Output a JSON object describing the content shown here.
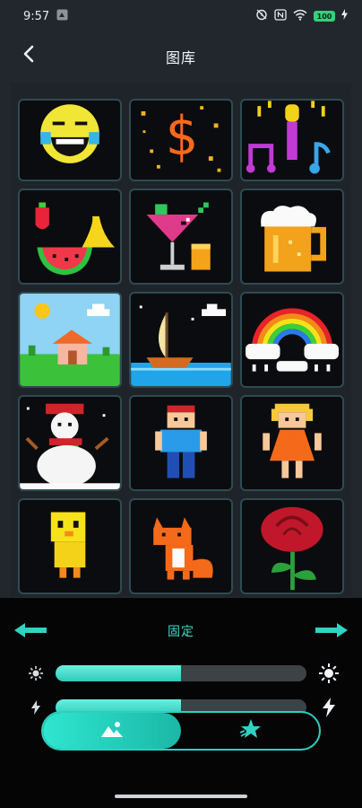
{
  "status_bar": {
    "time": "9:57",
    "battery": "100",
    "icons": [
      "notification-icon",
      "alarm-icon",
      "nfc-icon",
      "wifi-icon",
      "battery-icon",
      "charging-icon"
    ]
  },
  "app_bar": {
    "title": "图库",
    "back_icon": "back-chevron-icon"
  },
  "gallery": {
    "items": [
      {
        "name": "laughing-emoji"
      },
      {
        "name": "dollar-sign"
      },
      {
        "name": "microphone-music"
      },
      {
        "name": "fruits"
      },
      {
        "name": "cocktail"
      },
      {
        "name": "beer-mug"
      },
      {
        "name": "house-landscape"
      },
      {
        "name": "sailboat-night"
      },
      {
        "name": "rainbow-clouds"
      },
      {
        "name": "snowman"
      },
      {
        "name": "pixel-boy"
      },
      {
        "name": "pixel-girl"
      },
      {
        "name": "yellow-bird"
      },
      {
        "name": "fox"
      },
      {
        "name": "red-rose"
      }
    ]
  },
  "controls": {
    "mode_label": "固定",
    "brightness": {
      "level": 0.5
    },
    "speed": {
      "level": 0.5
    },
    "toggle": {
      "selected": "image",
      "options": [
        "image-icon",
        "star-icon"
      ]
    },
    "accent_color": "#2fd3c2"
  }
}
